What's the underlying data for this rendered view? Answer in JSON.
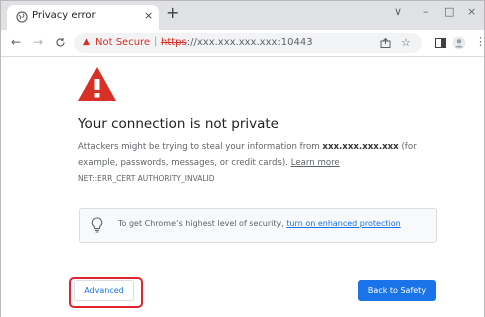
{
  "tab": {
    "title": "Privacy error",
    "close_glyph": "×",
    "new_tab_glyph": "+"
  },
  "window_controls": {
    "dropdown": "∨",
    "minimize": "–",
    "maximize": "□",
    "close": "×"
  },
  "toolbar": {
    "back": "←",
    "forward": "→",
    "reload": "C",
    "security_label": "Not Secure",
    "url_scheme": "https",
    "url_rest": "://xxx.xxx.xxx.xxx:10443",
    "icons": [
      "share-icon",
      "star-icon",
      "side-panel-icon",
      "profile-icon",
      "menu-icon"
    ]
  },
  "page": {
    "heading": "Your connection is not private",
    "para_prefix": "Attackers might be trying to steal your information from ",
    "host": "xxx.xxx.xxx.xxx",
    "para_suffix": " (for example, passwords, messages, or credit cards). ",
    "learn_more": "Learn more",
    "error_code": "NET::ERR_CERT AUTHORITY_INVALID",
    "security_prefix": "To get Chrome’s highest level of security, ",
    "security_link": "turn on enhanced protection",
    "advanced_label": "Advanced",
    "back_label": "Back to Safety"
  },
  "colors": {
    "warning_red": "#d93025",
    "accent_blue": "#1a73e8",
    "highlight_red": "#e0242d"
  }
}
